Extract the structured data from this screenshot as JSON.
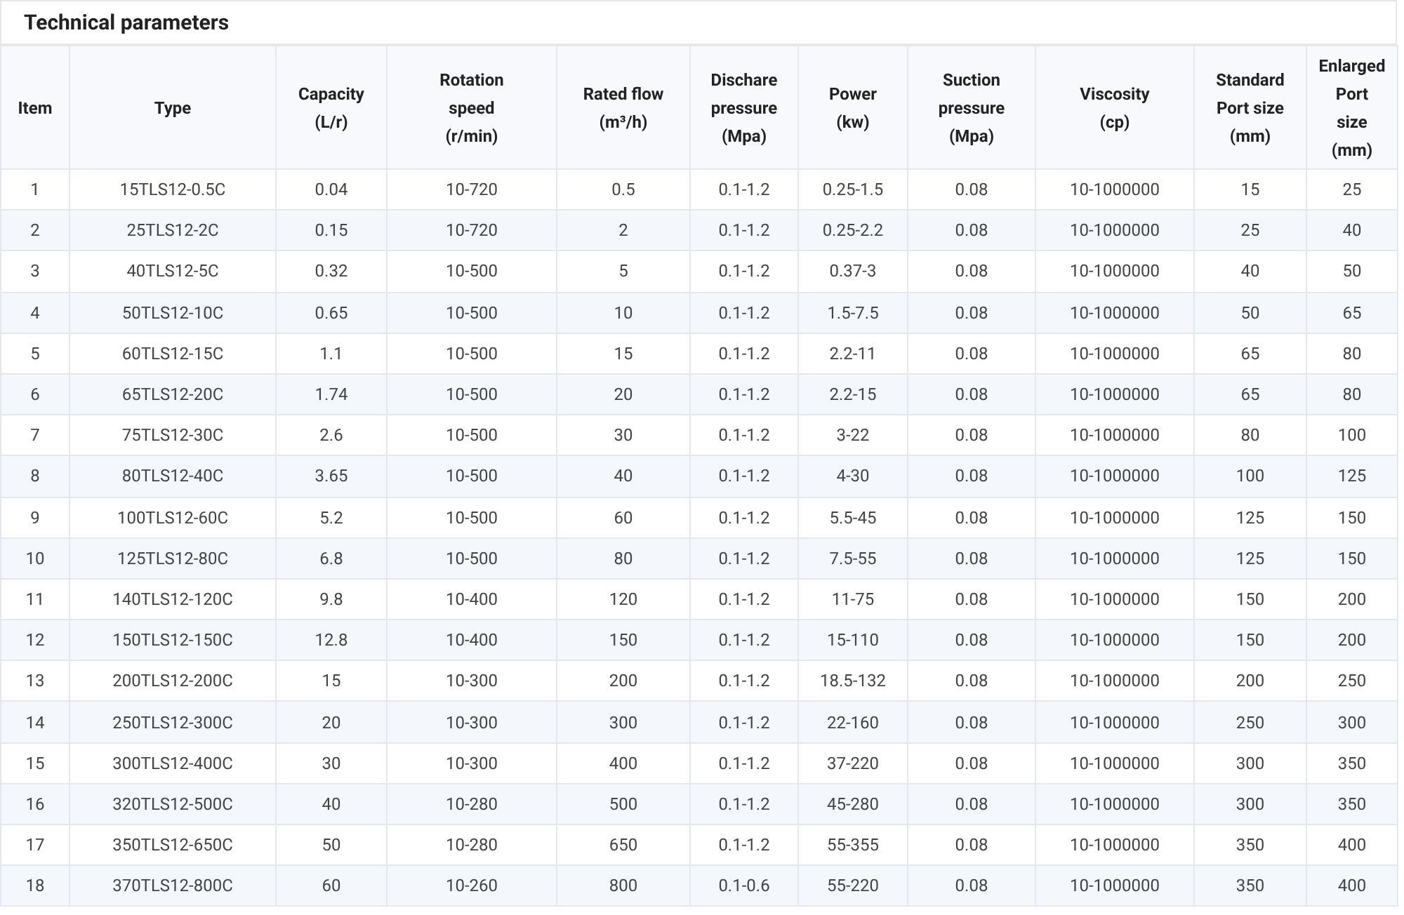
{
  "title": "Technical parameters",
  "table": {
    "columns": [
      "Item",
      "Type",
      "Capacity\n(L/r)",
      "Rotation\nspeed\n(r/min)",
      "Rated flow\n(m³/h)",
      "Discharе\npressure\n(Mpa)",
      "Power\n(kw)",
      "Suction\npressure\n(Mpa)",
      "Viscosity\n(cp)",
      "Standard\nPort size\n(mm)",
      "Enlarged\nPort\nsize\n(mm)"
    ],
    "rows": [
      [
        "1",
        "15TLS12-0.5C",
        "0.04",
        "10-720",
        "0.5",
        "0.1-1.2",
        "0.25-1.5",
        "0.08",
        "10-1000000",
        "15",
        "25"
      ],
      [
        "2",
        "25TLS12-2C",
        "0.15",
        "10-720",
        "2",
        "0.1-1.2",
        "0.25-2.2",
        "0.08",
        "10-1000000",
        "25",
        "40"
      ],
      [
        "3",
        "40TLS12-5C",
        "0.32",
        "10-500",
        "5",
        "0.1-1.2",
        "0.37-3",
        "0.08",
        "10-1000000",
        "40",
        "50"
      ],
      [
        "4",
        "50TLS12-10C",
        "0.65",
        "10-500",
        "10",
        "0.1-1.2",
        "1.5-7.5",
        "0.08",
        "10-1000000",
        "50",
        "65"
      ],
      [
        "5",
        "60TLS12-15C",
        "1.1",
        "10-500",
        "15",
        "0.1-1.2",
        "2.2-11",
        "0.08",
        "10-1000000",
        "65",
        "80"
      ],
      [
        "6",
        "65TLS12-20C",
        "1.74",
        "10-500",
        "20",
        "0.1-1.2",
        "2.2-15",
        "0.08",
        "10-1000000",
        "65",
        "80"
      ],
      [
        "7",
        "75TLS12-30C",
        "2.6",
        "10-500",
        "30",
        "0.1-1.2",
        "3-22",
        "0.08",
        "10-1000000",
        "80",
        "100"
      ],
      [
        "8",
        "80TLS12-40C",
        "3.65",
        "10-500",
        "40",
        "0.1-1.2",
        "4-30",
        "0.08",
        "10-1000000",
        "100",
        "125"
      ],
      [
        "9",
        "100TLS12-60C",
        "5.2",
        "10-500",
        "60",
        "0.1-1.2",
        "5.5-45",
        "0.08",
        "10-1000000",
        "125",
        "150"
      ],
      [
        "10",
        "125TLS12-80C",
        "6.8",
        "10-500",
        "80",
        "0.1-1.2",
        "7.5-55",
        "0.08",
        "10-1000000",
        "125",
        "150"
      ],
      [
        "11",
        "140TLS12-120C",
        "9.8",
        "10-400",
        "120",
        "0.1-1.2",
        "11-75",
        "0.08",
        "10-1000000",
        "150",
        "200"
      ],
      [
        "12",
        "150TLS12-150C",
        "12.8",
        "10-400",
        "150",
        "0.1-1.2",
        "15-110",
        "0.08",
        "10-1000000",
        "150",
        "200"
      ],
      [
        "13",
        "200TLS12-200C",
        "15",
        "10-300",
        "200",
        "0.1-1.2",
        "18.5-132",
        "0.08",
        "10-1000000",
        "200",
        "250"
      ],
      [
        "14",
        "250TLS12-300C",
        "20",
        "10-300",
        "300",
        "0.1-1.2",
        "22-160",
        "0.08",
        "10-1000000",
        "250",
        "300"
      ],
      [
        "15",
        "300TLS12-400C",
        "30",
        "10-300",
        "400",
        "0.1-1.2",
        "37-220",
        "0.08",
        "10-1000000",
        "300",
        "350"
      ],
      [
        "16",
        "320TLS12-500C",
        "40",
        "10-280",
        "500",
        "0.1-1.2",
        "45-280",
        "0.08",
        "10-1000000",
        "300",
        "350"
      ],
      [
        "17",
        "350TLS12-650C",
        "50",
        "10-280",
        "650",
        "0.1-1.2",
        "55-355",
        "0.08",
        "10-1000000",
        "350",
        "400"
      ],
      [
        "18",
        "370TLS12-800C",
        "60",
        "10-260",
        "800",
        "0.1-0.6",
        "55-220",
        "0.08",
        "10-1000000",
        "350",
        "400"
      ]
    ]
  }
}
